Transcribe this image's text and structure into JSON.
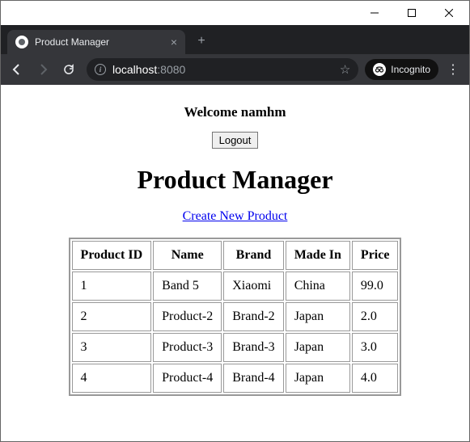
{
  "browser": {
    "tab_title": "Product Manager",
    "url_host": "localhost",
    "url_port": ":8080",
    "incognito_label": "Incognito"
  },
  "page": {
    "welcome_text": "Welcome namhm",
    "logout_label": "Logout",
    "title": "Product Manager",
    "create_link_label": "Create New Product",
    "table": {
      "headers": [
        "Product ID",
        "Name",
        "Brand",
        "Made In",
        "Price"
      ],
      "rows": [
        {
          "id": "1",
          "name": "Band 5",
          "brand": "Xiaomi",
          "made_in": "China",
          "price": "99.0"
        },
        {
          "id": "2",
          "name": "Product-2",
          "brand": "Brand-2",
          "made_in": "Japan",
          "price": "2.0"
        },
        {
          "id": "3",
          "name": "Product-3",
          "brand": "Brand-3",
          "made_in": "Japan",
          "price": "3.0"
        },
        {
          "id": "4",
          "name": "Product-4",
          "brand": "Brand-4",
          "made_in": "Japan",
          "price": "4.0"
        }
      ]
    }
  }
}
